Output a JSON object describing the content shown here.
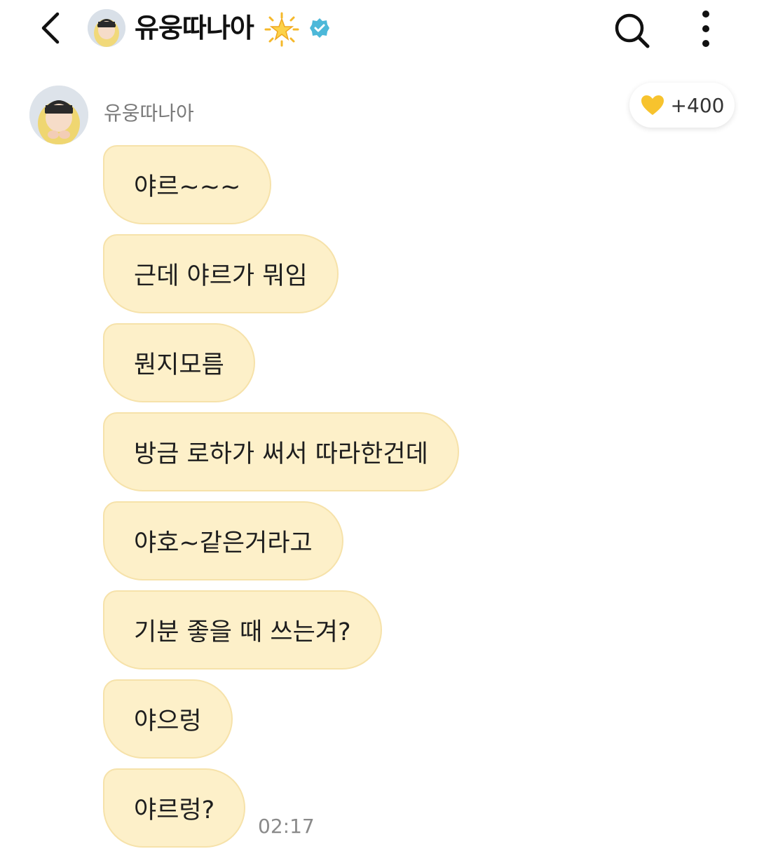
{
  "header": {
    "title": "유웅따나아",
    "back_icon": "chevron-left-icon",
    "emoji": "glowing-star",
    "verified_color": "#4cb8d9",
    "search_icon": "search-icon",
    "more_icon": "more-vertical-icon"
  },
  "message_group": {
    "sender": "유웅따나아",
    "heart_badge": {
      "icon": "yellow-heart-icon",
      "count": "+400",
      "color": "#f7c32e"
    },
    "bubble_color": "#fdf0c9",
    "messages": [
      "야르~~~",
      "근데 야르가 뭐임",
      "뭔지모름",
      "방금 로하가 써서 따라한건데",
      "야호~같은거라고",
      "기분 좋을 때 쓰는겨?",
      "야으렁",
      "야르렁?"
    ],
    "time": "02:17"
  }
}
